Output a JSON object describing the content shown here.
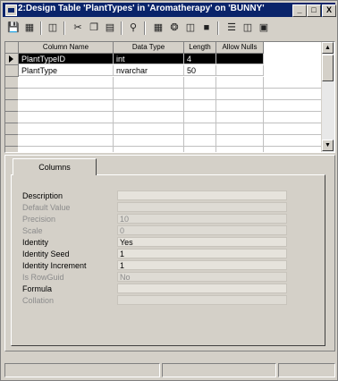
{
  "window": {
    "title": "2:Design Table 'PlantTypes' in 'Aromatherapy' on 'BUNNY'",
    "minimize": "_",
    "maximize": "□",
    "close": "X"
  },
  "toolbar": {
    "icons": [
      "save-icon",
      "properties-icon",
      "generate-script-icon",
      "cut-icon",
      "copy-icon",
      "paste-icon",
      "primary-key-icon",
      "manage-triggers-icon",
      "manage-indexes-icon",
      "manage-relationships-icon",
      "manage-constraints-icon",
      "new-relationship-icon",
      "insert-column-icon",
      "delete-column-icon"
    ]
  },
  "grid": {
    "columns": [
      "Column Name",
      "Data Type",
      "Length",
      "Allow Nulls"
    ],
    "rows": [
      {
        "name": "PlantTypeID",
        "type": "int",
        "length": "4",
        "nulls": ""
      },
      {
        "name": "PlantType",
        "type": "nvarchar",
        "length": "50",
        "nulls": ""
      }
    ]
  },
  "properties": {
    "tab_label": "Columns",
    "items": [
      {
        "label": "Description",
        "value": "",
        "enabled": true
      },
      {
        "label": "Default Value",
        "value": "",
        "enabled": false
      },
      {
        "label": "Precision",
        "value": "10",
        "enabled": false
      },
      {
        "label": "Scale",
        "value": "0",
        "enabled": false
      },
      {
        "label": "Identity",
        "value": "Yes",
        "enabled": true
      },
      {
        "label": "Identity Seed",
        "value": "1",
        "enabled": true
      },
      {
        "label": "Identity Increment",
        "value": "1",
        "enabled": true
      },
      {
        "label": "Is RowGuid",
        "value": "No",
        "enabled": false
      },
      {
        "label": "Formula",
        "value": "",
        "enabled": true
      },
      {
        "label": "Collation",
        "value": "",
        "enabled": false
      }
    ]
  }
}
